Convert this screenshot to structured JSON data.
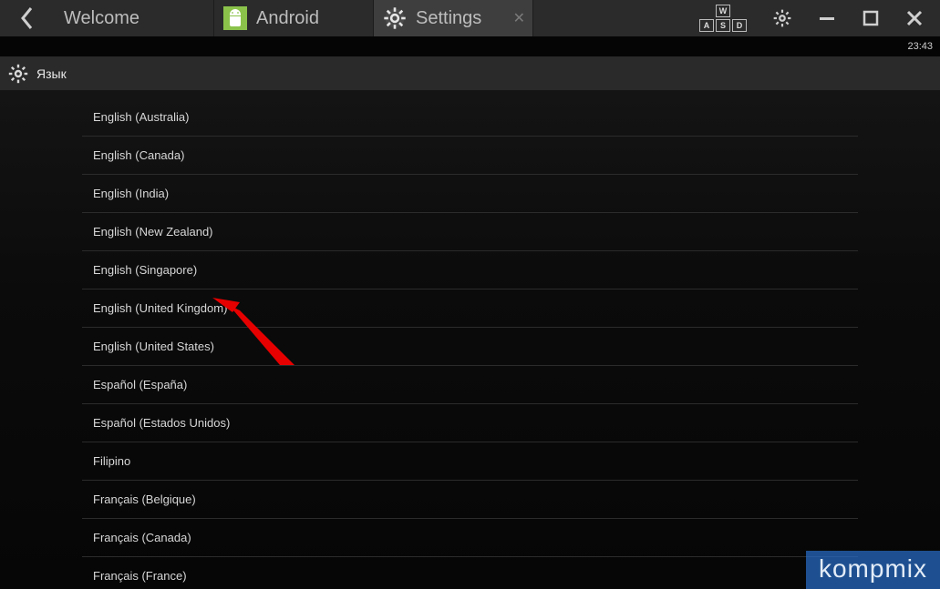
{
  "titlebar": {
    "tabs": [
      {
        "label": "Welcome",
        "active": false
      },
      {
        "label": "Android",
        "active": false
      },
      {
        "label": "Settings",
        "active": true
      }
    ],
    "wasd_keys": {
      "w": "W",
      "a": "A",
      "s": "S",
      "d": "D"
    }
  },
  "statusbar": {
    "time": "23:43"
  },
  "subheader": {
    "title": "Язык"
  },
  "languages": [
    "English (Australia)",
    "English (Canada)",
    "English (India)",
    "English (New Zealand)",
    "English (Singapore)",
    "English (United Kingdom)",
    "English (United States)",
    "Español (España)",
    "Español (Estados Unidos)",
    "Filipino",
    "Français (Belgique)",
    "Français (Canada)",
    "Français (France)"
  ],
  "watermark": "kompmix"
}
